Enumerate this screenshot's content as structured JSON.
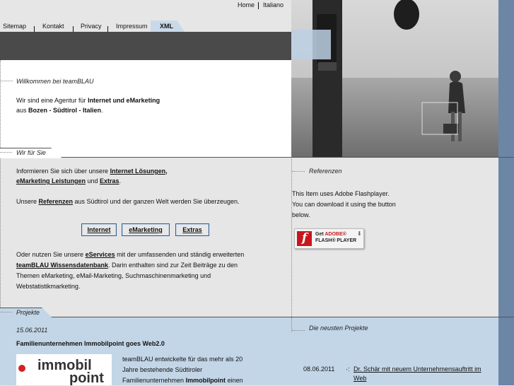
{
  "topnav": {
    "home": "Home",
    "italiano": "Italiano"
  },
  "tabs": {
    "sitemap": "Sitemap",
    "kontakt": "Kontakt",
    "privacy": "Privacy",
    "impressum": "Impressum",
    "xml": "XML"
  },
  "welcome": {
    "title": "Willkommen bei teamBLAU",
    "line1_a": "Wir sind eine Agentur für ",
    "line1_b": "Internet und eMarketing",
    "line2_a": "aus ",
    "line2_b": "Bozen - Südtirol - Italien",
    "line2_c": "."
  },
  "wir": {
    "title": "Wir für Sie",
    "p1_a": "Informieren Sie sich über unsere ",
    "p1_link1": "Internet Lösungen",
    "p1_b": ",",
    "p1_link2": "eMarketing Leistungen",
    "p1_c": " und ",
    "p1_link3": "Extras",
    "p1_d": ".",
    "p2_a": "Unsere ",
    "p2_link": "Referenzen",
    "p2_b": " aus Südtirol und der ganzen Welt werden Sie überzeugen.",
    "btn_internet": "Internet",
    "btn_emarketing": "eMarketing",
    "btn_extras": "Extras",
    "p3_a": "Oder nutzen Sie unsere ",
    "p3_link1": "eServices",
    "p3_b": " mit der umfassenden und ständig erweiterten",
    "p3_link2": "teamBLAU Wissensdatenbank",
    "p3_c": ". Darin enthalten sind zur Zeit Beiträge zu den",
    "p3_d": "Themen eMarketing, eMail-Marketing, Suchmaschinenmarketing und",
    "p3_e": "Webstatistikmarketing."
  },
  "referenzen": {
    "title": "Referenzen",
    "l1": "This Item uses Adobe Flashplayer.",
    "l2": "You can download it using the button",
    "l3": "below.",
    "flash_get": "Get ",
    "flash_adobe": "ADOBE®",
    "flash_player": "FLASH® PLAYER"
  },
  "projekte": {
    "title": "Projekte",
    "date": "15.06.2011",
    "headline": "Familienunternehmen Immobilpoint goes Web2.0",
    "logo_line1": "immobil",
    "logo_line2": "point",
    "t1": "teamBLAU entwickelte für das mehr als 20",
    "t2": "Jahre bestehende Südtiroler",
    "t3_a": "Familienunternehmen ",
    "t3_b": "Immobilpoint",
    "t3_c": " einen"
  },
  "neueste": {
    "title": "Die neusten Projekte",
    "date": "08.06.2011",
    "link_l1": "Dr. Schär mit neuem Unternehmensauftritt im",
    "link_l2": "Web"
  },
  "colors": {
    "accent_blue": "#c3d6e7",
    "dark_bar": "#4a4a4a",
    "side_blue": "#6c86a6",
    "flash_red": "#c8161d"
  }
}
